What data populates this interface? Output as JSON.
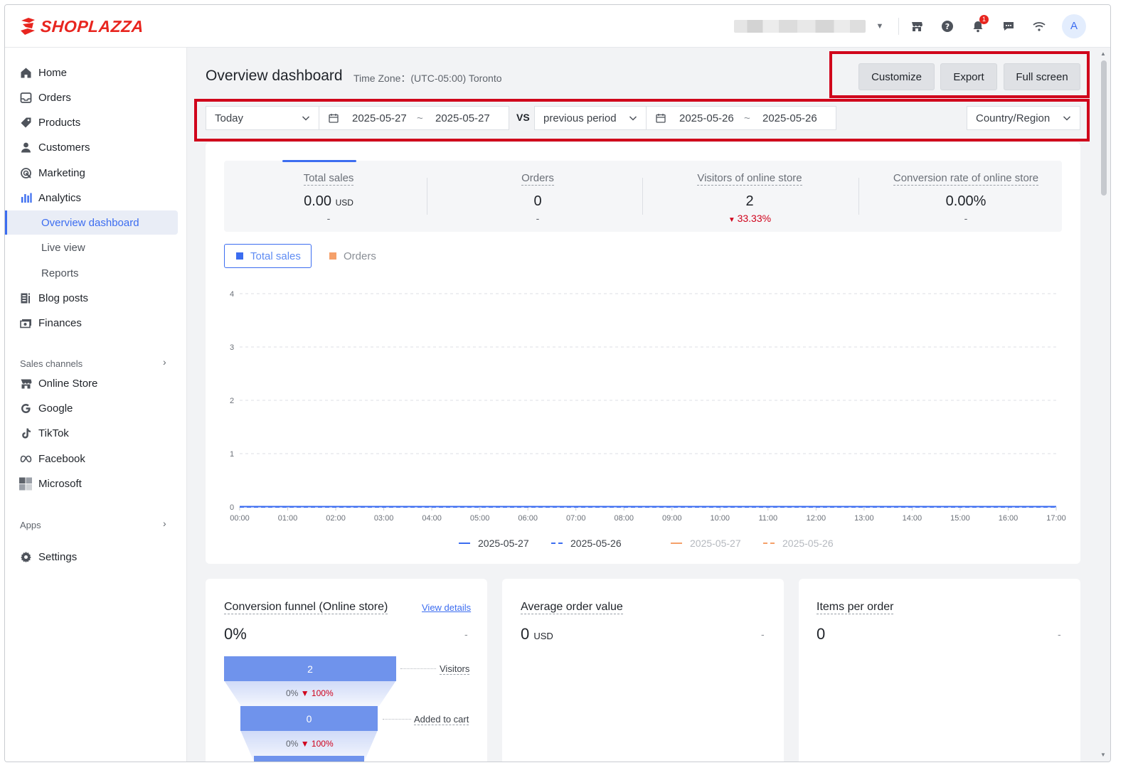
{
  "brand": {
    "name": "SHOPLAZZA",
    "color": "#e8251f"
  },
  "topbar": {
    "notifications_count": "1",
    "avatar_letter": "A",
    "icons": [
      "store-icon",
      "help-icon",
      "bell-icon",
      "chat-icon",
      "wifi-icon"
    ]
  },
  "sidebar": {
    "items": [
      {
        "label": "Home",
        "icon": "home-icon"
      },
      {
        "label": "Orders",
        "icon": "orders-icon"
      },
      {
        "label": "Products",
        "icon": "tag-icon"
      },
      {
        "label": "Customers",
        "icon": "user-icon"
      },
      {
        "label": "Marketing",
        "icon": "marketing-icon"
      },
      {
        "label": "Analytics",
        "icon": "analytics-icon"
      }
    ],
    "analytics_sub": [
      "Overview dashboard",
      "Live view",
      "Reports"
    ],
    "items2": [
      {
        "label": "Blog posts",
        "icon": "blog-icon"
      },
      {
        "label": "Finances",
        "icon": "finances-icon"
      }
    ],
    "sales_channels_label": "Sales channels",
    "channels": [
      {
        "label": "Online Store",
        "icon": "store-icon"
      },
      {
        "label": "Google",
        "icon": "google-icon"
      },
      {
        "label": "TikTok",
        "icon": "tiktok-icon"
      },
      {
        "label": "Facebook",
        "icon": "meta-icon"
      },
      {
        "label": "Microsoft",
        "icon": "microsoft-icon"
      }
    ],
    "apps_label": "Apps",
    "settings_label": "Settings"
  },
  "header": {
    "title": "Overview dashboard",
    "timezone": "Time Zone：(UTC-05:00) Toronto",
    "buttons": {
      "customize": "Customize",
      "export": "Export",
      "fullscreen": "Full screen"
    }
  },
  "filters": {
    "range": "Today",
    "start": "2025-05-27",
    "end": "2025-05-27",
    "tilde": "~",
    "vs": "VS",
    "compare": "previous period",
    "compare_start": "2025-05-26",
    "compare_end": "2025-05-26",
    "region": "Country/Region"
  },
  "metrics": [
    {
      "label": "Total sales",
      "value": "0.00",
      "unit": "USD",
      "delta": "-",
      "down": false
    },
    {
      "label": "Orders",
      "value": "0",
      "unit": "",
      "delta": "-",
      "down": false
    },
    {
      "label": "Visitors of online store",
      "value": "2",
      "unit": "",
      "delta": "33.33%",
      "down": true
    },
    {
      "label": "Conversion rate of online store",
      "value": "0.00%",
      "unit": "",
      "delta": "-",
      "down": false
    }
  ],
  "chart_legend_toggle": {
    "total_sales": "Total sales",
    "orders": "Orders"
  },
  "chart_data": {
    "type": "line",
    "x": [
      "00:00",
      "01:00",
      "02:00",
      "03:00",
      "04:00",
      "05:00",
      "06:00",
      "07:00",
      "08:00",
      "09:00",
      "10:00",
      "11:00",
      "12:00",
      "13:00",
      "14:00",
      "15:00",
      "16:00",
      "17:00"
    ],
    "ylim": [
      0,
      4
    ],
    "yticks": [
      0,
      1,
      2,
      3,
      4
    ],
    "grid": true,
    "legend_position": "bottom",
    "series": [
      {
        "name": "2025-05-27",
        "metric": "Total sales",
        "color": "#3c6df0",
        "dash": false,
        "values": [
          0,
          0,
          0,
          0,
          0,
          0,
          0,
          0,
          0,
          0,
          0,
          0,
          0,
          0,
          0,
          0,
          0,
          0
        ]
      },
      {
        "name": "2025-05-26",
        "metric": "Total sales",
        "color": "#3c6df0",
        "dash": true,
        "values": [
          0,
          0,
          0,
          0,
          0,
          0,
          0,
          0,
          0,
          0,
          0,
          0,
          0,
          0,
          0,
          0,
          0,
          0
        ]
      },
      {
        "name": "2025-05-27",
        "metric": "Orders",
        "color": "#f5a06a",
        "dash": false,
        "values": []
      },
      {
        "name": "2025-05-26",
        "metric": "Orders",
        "color": "#f5a06a",
        "dash": true,
        "values": []
      }
    ]
  },
  "funnel": {
    "title": "Conversion funnel (Online store)",
    "view_details": "View details",
    "rate": "0%",
    "dash": "-",
    "steps": [
      {
        "value": "2",
        "label": "Visitors"
      },
      {
        "value": "0",
        "label": "Added to cart"
      }
    ],
    "conversions": [
      {
        "pct": "0%",
        "drop": "100%"
      },
      {
        "pct": "0%",
        "drop": "100%"
      }
    ]
  },
  "aov": {
    "title": "Average order value",
    "value": "0",
    "unit": "USD",
    "dash": "-"
  },
  "ipo": {
    "title": "Items per order",
    "value": "0",
    "dash": "-"
  }
}
